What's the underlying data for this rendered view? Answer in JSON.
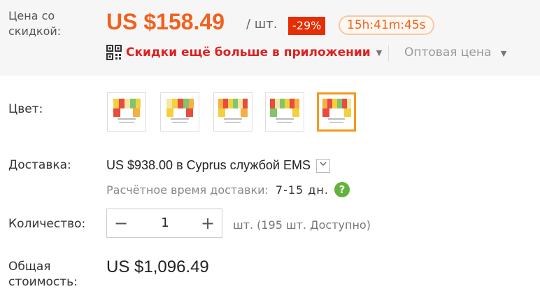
{
  "price_block": {
    "label": "Цена со скидкой:",
    "price": "US $158.49",
    "unit": "/ шт.",
    "discount": "-29%",
    "timer": "15h:41m:45s"
  },
  "promo": {
    "icon": "qr-code-icon",
    "text": "Скидки ещё больше в приложении",
    "caret": "▼",
    "wholesale": "Оптовая цена",
    "wholesale_caret": "▼"
  },
  "color": {
    "label": "Цвет:",
    "swatches": 5,
    "selected_index": 4
  },
  "shipping": {
    "label": "Доставка:",
    "text": "US $938.00 в Cyprus службой EMS",
    "dropdown_icon": "chevron-down-icon",
    "eta_label": "Расчётное время доставки:",
    "eta_value": "7-15 дн.",
    "help_icon": "help-icon",
    "help_glyph": "?"
  },
  "quantity": {
    "label": "Количество:",
    "minus": "−",
    "value": "1",
    "plus": "+",
    "stock": "шт. (195 шт. Доступно)"
  },
  "total": {
    "label": "Общая стоимость:",
    "value": "US $1,096.49"
  }
}
